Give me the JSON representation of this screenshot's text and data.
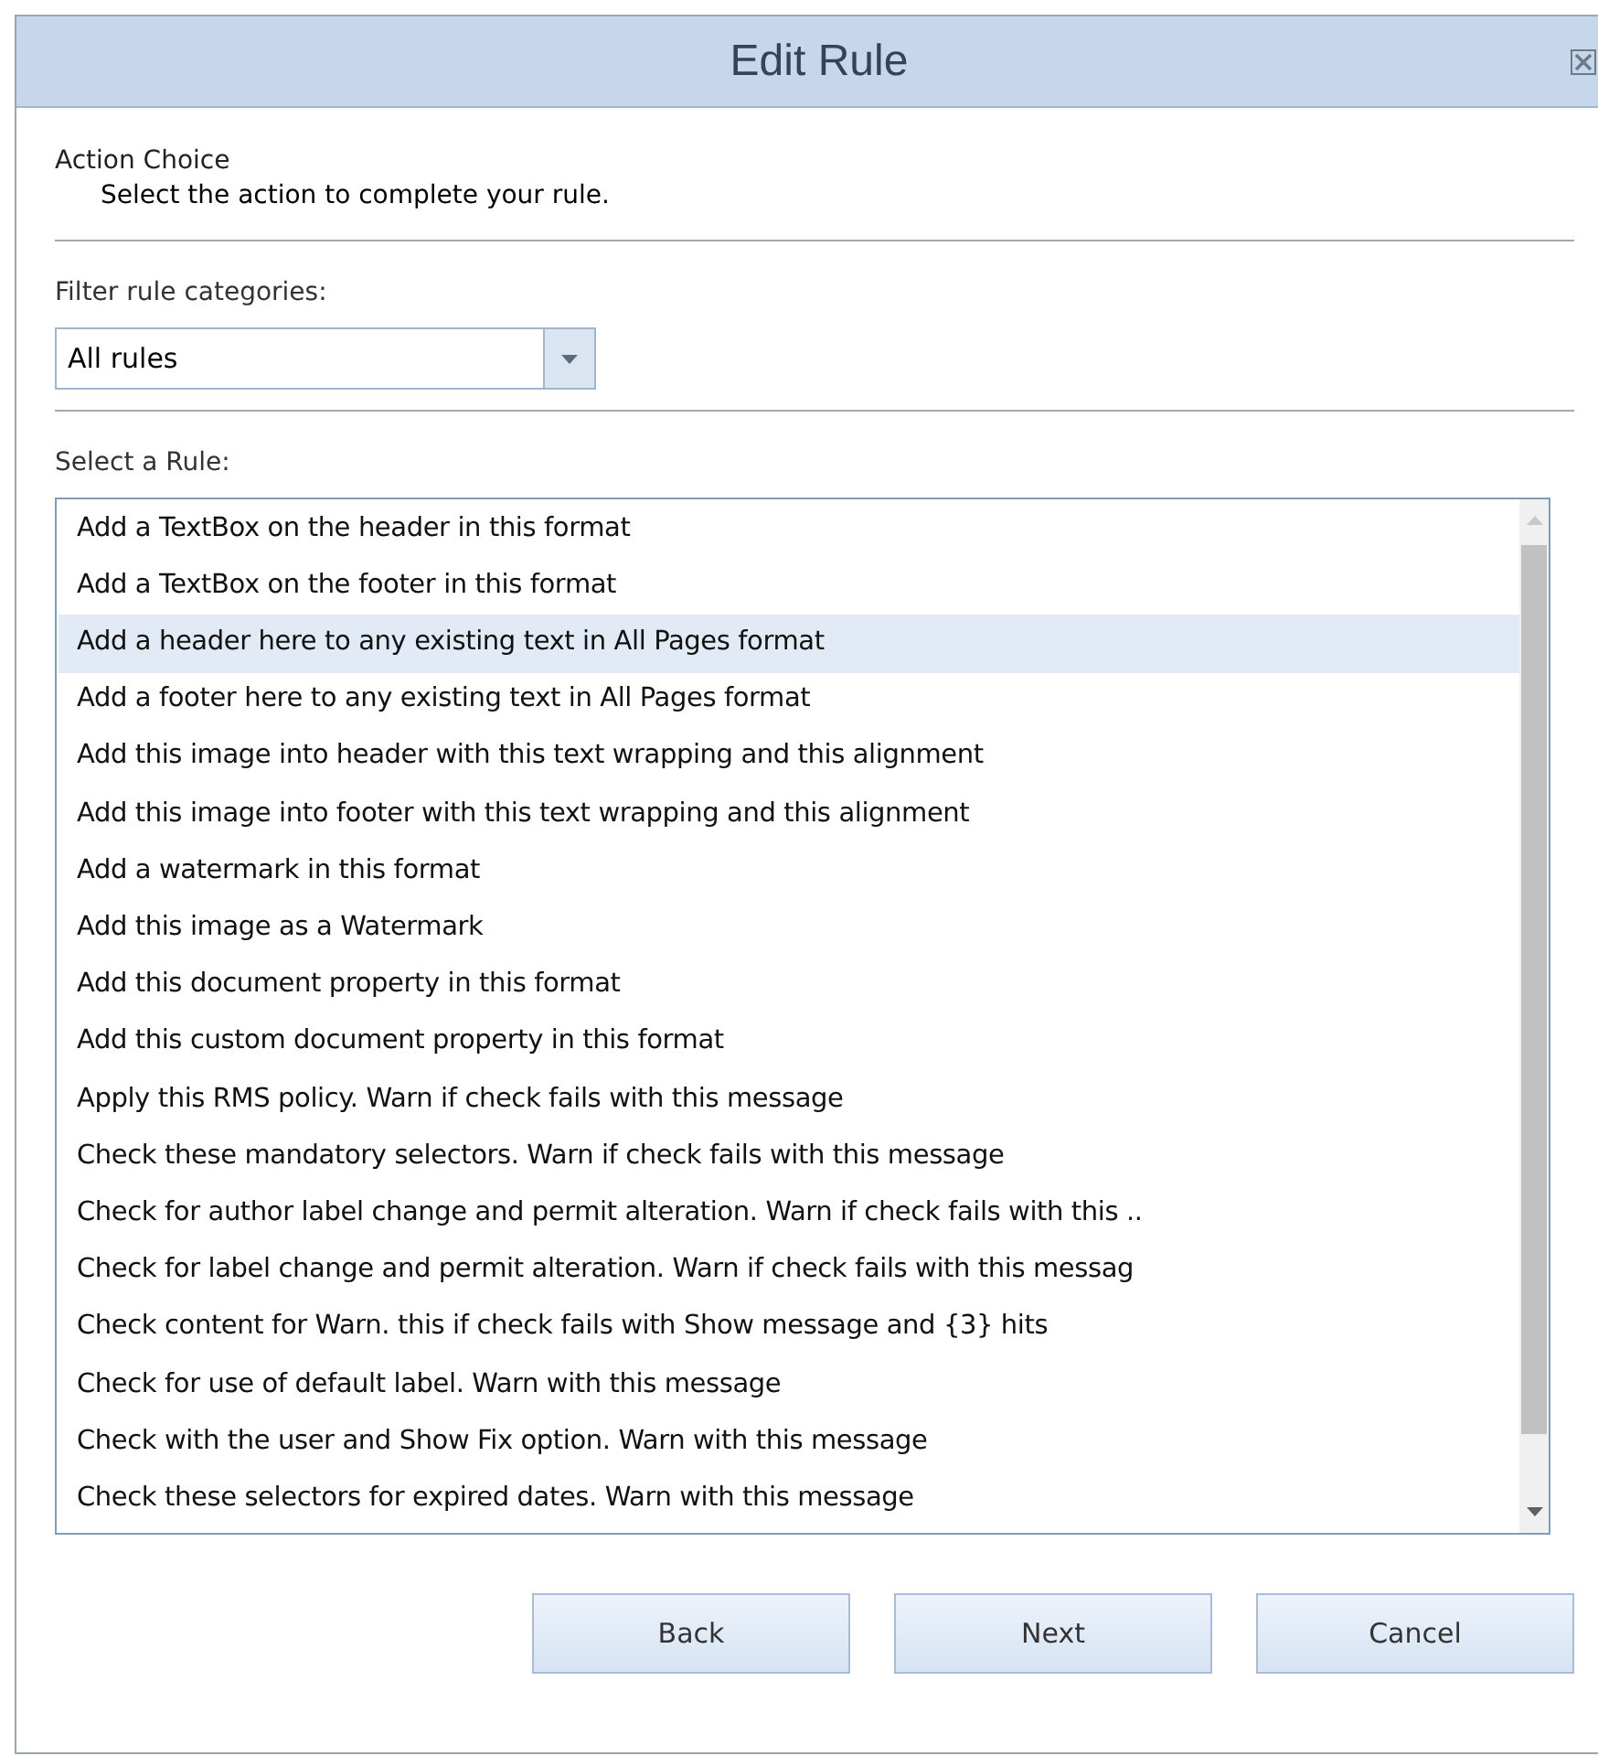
{
  "window": {
    "title": "Edit Rule"
  },
  "section": {
    "heading": "Action Choice",
    "description": "Select the action to complete your rule."
  },
  "filter": {
    "label": "Filter rule categories:",
    "value": "All rules"
  },
  "rules": {
    "label": "Select a Rule:",
    "items": [
      {
        "text": "Add a TextBox on the header in this format",
        "selected": false
      },
      {
        "text": "Add a TextBox on the footer in this format",
        "selected": false
      },
      {
        "text": "Add a header here to any existing text in All Pages format",
        "selected": true
      },
      {
        "text": "Add a footer here to any existing text in All Pages format",
        "selected": false
      },
      {
        "text": "Add this image into header with this text wrapping and this alignment",
        "selected": false
      },
      {
        "text": "Add this image into footer with this text wrapping and this alignment",
        "selected": false
      },
      {
        "text": "Add a watermark in this format",
        "selected": false
      },
      {
        "text": "Add this image as a Watermark",
        "selected": false
      },
      {
        "text": "Add this document property in this format",
        "selected": false
      },
      {
        "text": "Add this custom document property in this format",
        "selected": false
      },
      {
        "text": "Apply this RMS policy. Warn if check fails with this message",
        "selected": false
      },
      {
        "text": "Check these mandatory selectors. Warn if check fails with this message",
        "selected": false
      },
      {
        "text": "Check for author label change and permit alteration. Warn if check fails with this ..",
        "selected": false
      },
      {
        "text": "Check for label change and permit alteration. Warn if check fails with this messag",
        "selected": false
      },
      {
        "text": "Check content for Warn. this if check fails with Show message and {3} hits",
        "selected": false
      },
      {
        "text": "Check for use of default label. Warn with this message",
        "selected": false
      },
      {
        "text": "Check with the user and Show Fix option. Warn with this message",
        "selected": false
      },
      {
        "text": "Check these selectors for expired dates. Warn with this message",
        "selected": false
      }
    ]
  },
  "buttons": [
    "Back",
    "Next",
    "Cancel"
  ]
}
